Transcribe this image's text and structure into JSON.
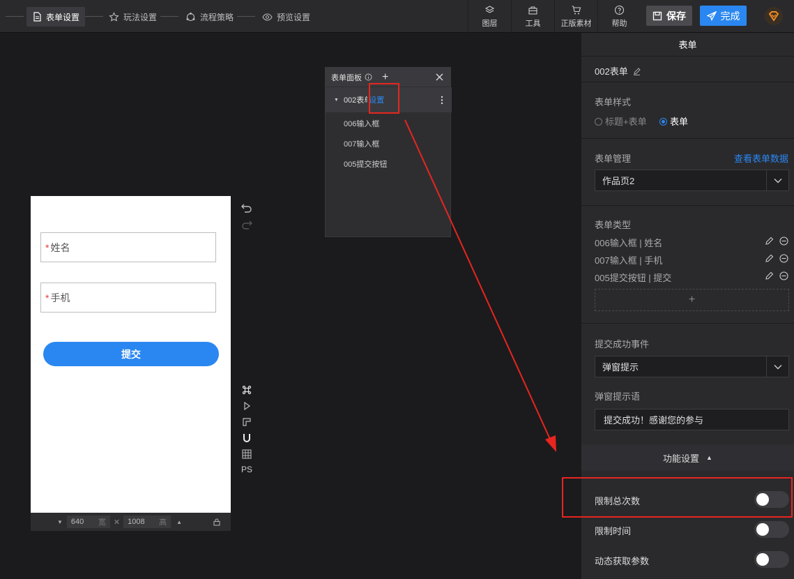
{
  "topbar": {
    "steps": [
      "表单设置",
      "玩法设置",
      "流程策略",
      "预览设置"
    ],
    "tools": [
      "图层",
      "工具",
      "正版素材",
      "帮助"
    ],
    "save_label": "保存",
    "done_label": "完成"
  },
  "phone": {
    "field1": "姓名",
    "field2": "手机",
    "submit": "提交",
    "required_mark": "*"
  },
  "sizebar": {
    "width": "640",
    "width_unit": "宽",
    "height": "1008",
    "height_unit": "高"
  },
  "side_tools_text": "PS",
  "form_panel": {
    "title": "表单面板",
    "form_name": "002表单",
    "settings_link": "设置",
    "items": [
      "006输入框",
      "007输入框",
      "005提交按钮"
    ]
  },
  "right_panel": {
    "title": "表单",
    "form_name": "002表单",
    "style_label": "表单样式",
    "style_options": [
      "标题+表单",
      "表单"
    ],
    "manage_label": "表单管理",
    "view_data_link": "查看表单数据",
    "manage_select": "作品页2",
    "type_label": "表单类型",
    "type_items": [
      "006输入框 | 姓名",
      "007输入框 | 手机",
      "005提交按钮 | 提交"
    ],
    "add_label": "+",
    "success_label": "提交成功事件",
    "success_select": "弹窗提示",
    "popup_label": "弹窗提示语",
    "popup_text": "提交成功！感谢您的参与",
    "func_label": "功能设置",
    "func_caret": "▲",
    "toggles": [
      "限制总次数",
      "限制时间",
      "动态获取参数"
    ]
  },
  "colors": {
    "accent": "#2a87f1",
    "annotation": "#e8251f"
  }
}
